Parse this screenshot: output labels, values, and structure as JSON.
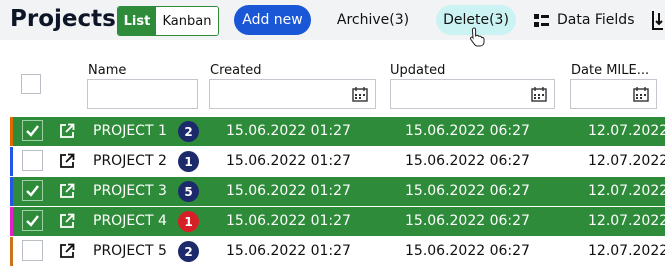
{
  "toolbar": {
    "title": "Projects",
    "view_list": "List",
    "view_kanban": "Kanban",
    "add_new": "Add new",
    "archive": "Archive(3)",
    "delete": "Delete(3)",
    "data_fields": "Data Fields"
  },
  "columns": {
    "name": "Name",
    "created": "Created",
    "updated": "Updated",
    "date_milestone": "Date MILE..."
  },
  "colors": {
    "selected_row": "#2e8b3a",
    "primary_button": "#1957d6",
    "delete_button": "#cbf3f4",
    "badge_navy": "#1c2a6b",
    "badge_red": "#d52027"
  },
  "rows": [
    {
      "name": "PROJECT 1",
      "count": "2",
      "created": "15.06.2022 01:27",
      "updated": "15.06.2022 06:27",
      "milestone": "12.07.2022",
      "selected": true,
      "stripe": "#e06a00",
      "badge": "#1c2a6b"
    },
    {
      "name": "PROJECT 2",
      "count": "1",
      "created": "15.06.2022 01:27",
      "updated": "15.06.2022 06:27",
      "milestone": "12.07.2022",
      "selected": false,
      "stripe": "#2255e8",
      "badge": "#1c2a6b"
    },
    {
      "name": "PROJECT 3",
      "count": "5",
      "created": "15.06.2022 01:27",
      "updated": "15.06.2022 06:27",
      "milestone": "12.07.2022",
      "selected": true,
      "stripe": "#2255e8",
      "badge": "#1c2a6b"
    },
    {
      "name": "PROJECT 4",
      "count": "1",
      "created": "15.06.2022 01:27",
      "updated": "15.06.2022 06:27",
      "milestone": "12.07.2022",
      "selected": true,
      "stripe": "#e020c8",
      "badge": "#d52027"
    },
    {
      "name": "PROJECT 5",
      "count": "2",
      "created": "15.06.2022 01:27",
      "updated": "15.06.2022 06:27",
      "milestone": "12.07.2022",
      "selected": false,
      "stripe": "#c9731a",
      "badge": "#1c2a6b"
    }
  ]
}
